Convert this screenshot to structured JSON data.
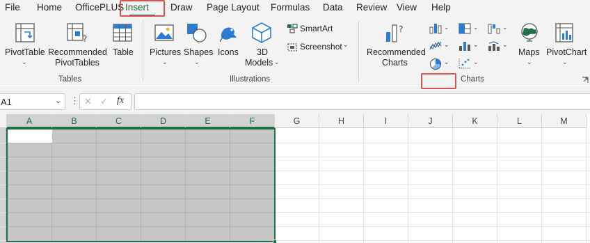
{
  "menu": {
    "tabs": [
      {
        "label": "File"
      },
      {
        "label": "Home"
      },
      {
        "label": "OfficePLUS"
      },
      {
        "label": "Insert"
      },
      {
        "label": "Draw"
      },
      {
        "label": "Page Layout"
      },
      {
        "label": "Formulas"
      },
      {
        "label": "Data"
      },
      {
        "label": "Review"
      },
      {
        "label": "View"
      },
      {
        "label": "Help"
      }
    ],
    "active_tab": "Insert"
  },
  "ribbon": {
    "tables": {
      "pivottable": "PivotTable",
      "recommended_line1": "Recommended",
      "recommended_line2": "PivotTables",
      "table": "Table",
      "group_label": "Tables"
    },
    "illustrations": {
      "pictures": "Pictures",
      "shapes": "Shapes",
      "icons": "Icons",
      "models_line1": "3D",
      "models_line2": "Models",
      "smartart": "SmartArt",
      "screenshot": "Screenshot",
      "group_label": "Illustrations"
    },
    "charts": {
      "recommended_line1": "Recommended",
      "recommended_line2": "Charts",
      "maps": "Maps",
      "pivotchart": "PivotChart",
      "group_label": "Charts"
    }
  },
  "formula_bar": {
    "name_box": "A1",
    "fx": "fx",
    "cancel_symbol": "✕",
    "enter_symbol": "✓",
    "more_symbol": "⋮",
    "formula": ""
  },
  "sheet": {
    "columns": [
      "A",
      "B",
      "C",
      "D",
      "E",
      "F",
      "G",
      "H",
      "I",
      "J",
      "K",
      "L",
      "M"
    ],
    "selected_columns": [
      "A",
      "B",
      "C",
      "D",
      "E",
      "F"
    ],
    "active_cell": "A1",
    "accent_color": "#1e7145"
  }
}
